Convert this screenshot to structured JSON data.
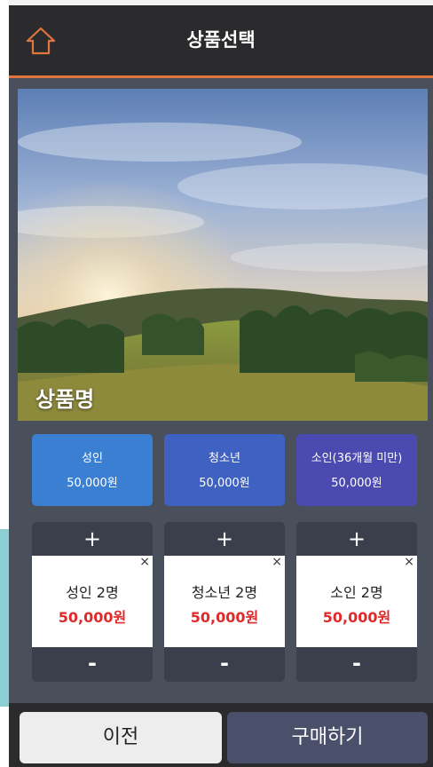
{
  "header": {
    "title": "상품선택",
    "home_icon": "home-icon",
    "accent_color": "#e0763f"
  },
  "product": {
    "name": "상품명"
  },
  "price_options": [
    {
      "label": "성인",
      "price": "50,000원",
      "color": "#3b7fd2"
    },
    {
      "label": "청소년",
      "price": "50,000원",
      "color": "#3f61c2"
    },
    {
      "label": "소인(36개월 미만)",
      "price": "50,000원",
      "color": "#4a4ab0"
    }
  ],
  "counters": [
    {
      "plus": "+",
      "minus": "-",
      "close": "×",
      "count_text": "성인 2명",
      "price": "50,000원"
    },
    {
      "plus": "+",
      "minus": "-",
      "close": "×",
      "count_text": "청소년 2명",
      "price": "50,000원"
    },
    {
      "plus": "+",
      "minus": "-",
      "close": "×",
      "count_text": "소인 2명",
      "price": "50,000원"
    }
  ],
  "footer": {
    "prev_label": "이전",
    "buy_label": "구매하기"
  }
}
